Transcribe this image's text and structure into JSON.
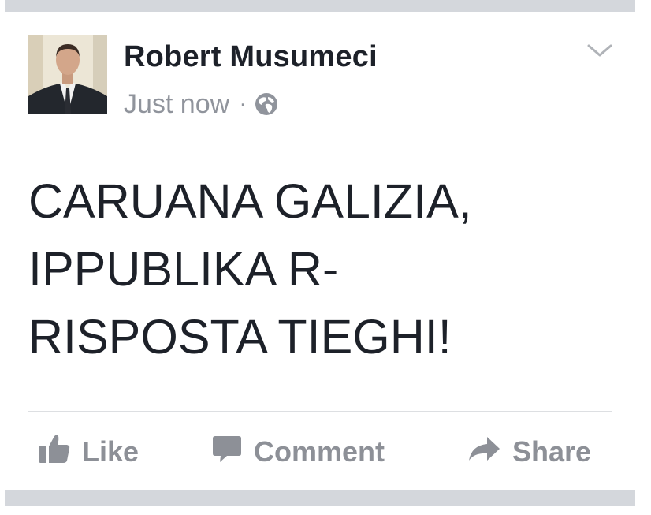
{
  "post": {
    "author_name": "Robert Musumeci",
    "timestamp": "Just now",
    "separator": "·",
    "privacy_icon": "globe-icon",
    "menu_icon": "chevron-down-icon",
    "lines": [
      "CARUANA GALIZIA,",
      "IPPUBLIKA R-",
      "RISPOSTA TIEGHI!"
    ]
  },
  "actions": {
    "like_label": "Like",
    "comment_label": "Comment",
    "share_label": "Share"
  },
  "colors": {
    "text": "#1d2129",
    "secondary": "#90949c",
    "separator_bar": "#d4d7dc",
    "action": "#8d9097"
  }
}
